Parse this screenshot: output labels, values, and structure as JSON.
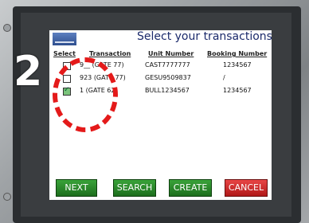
{
  "title": "Select your transactions.",
  "headers": {
    "select": "Select",
    "transaction": "Transaction",
    "unit": "Unit Number",
    "booking": "Booking Number"
  },
  "rows": [
    {
      "transaction": "9__ (GATE 77)",
      "unit": "CAST7777777",
      "booking": "1234567",
      "checked": false
    },
    {
      "transaction": "923 (GATE 77)",
      "unit": "GESU9509837",
      "booking": "/",
      "checked": false
    },
    {
      "transaction": "1 (GATE 62)",
      "unit": "BULL1234567",
      "booking": "1234567",
      "checked": true
    }
  ],
  "buttons": {
    "next": "NEXT",
    "search": "SEARCH",
    "create": "CREATE",
    "cancel": "CANCEL"
  },
  "overlay_number": "2"
}
